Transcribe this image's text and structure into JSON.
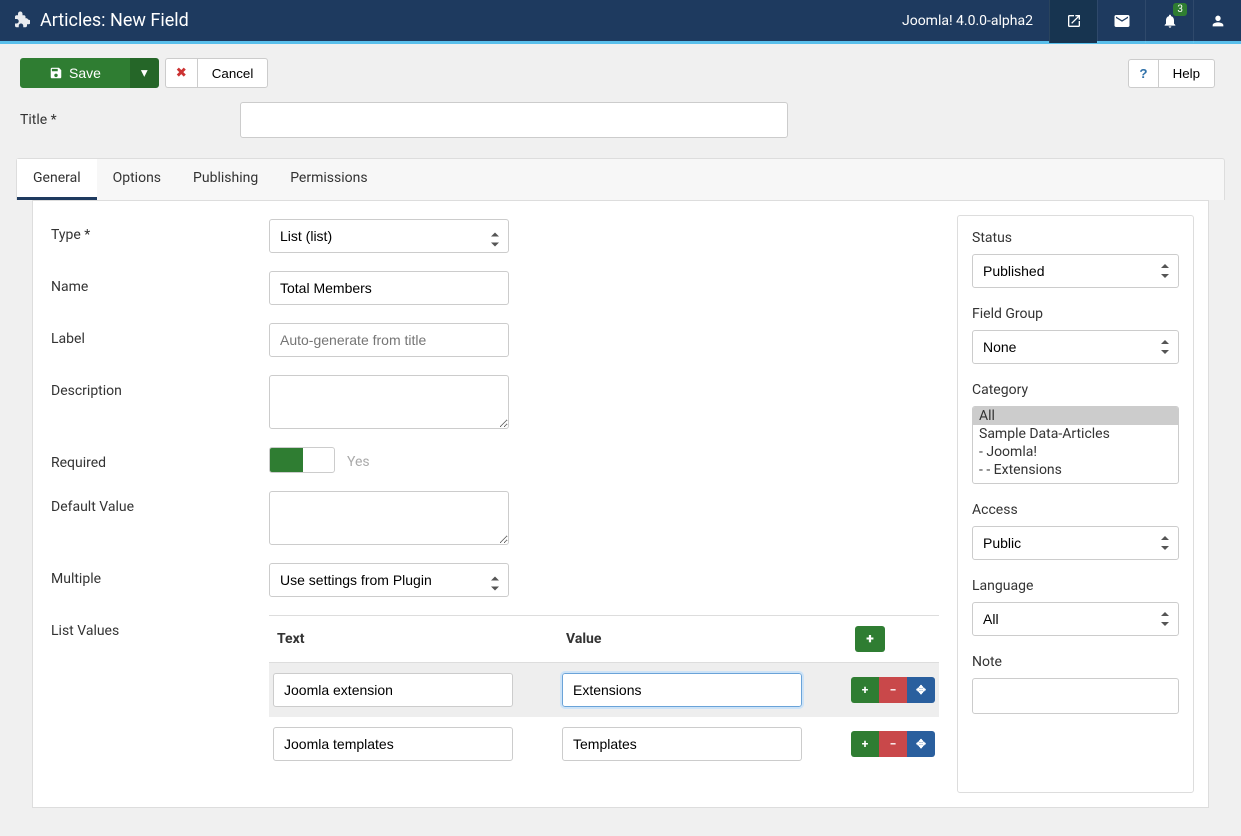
{
  "topbar": {
    "title": "Articles: New Field",
    "version": "Joomla! 4.0.0-alpha2",
    "notif_count": "3"
  },
  "toolbar": {
    "save": "Save",
    "cancel": "Cancel",
    "help": "Help"
  },
  "title_field": {
    "label": "Title *",
    "value": ""
  },
  "tabs": [
    "General",
    "Options",
    "Publishing",
    "Permissions"
  ],
  "form": {
    "type": {
      "label": "Type *",
      "value": "List (list)"
    },
    "name": {
      "label": "Name",
      "value": "Total Members"
    },
    "lbl": {
      "label": "Label",
      "placeholder": "Auto-generate from title",
      "value": ""
    },
    "description": {
      "label": "Description",
      "value": ""
    },
    "required": {
      "label": "Required",
      "text": "Yes"
    },
    "default_value": {
      "label": "Default Value",
      "value": ""
    },
    "multiple": {
      "label": "Multiple",
      "value": "Use settings from Plugin"
    },
    "list_values": {
      "label": "List Values",
      "th_text": "Text",
      "th_value": "Value",
      "rows": [
        {
          "text": "Joomla extension",
          "value": "Extensions"
        },
        {
          "text": "Joomla templates",
          "value": "Templates"
        }
      ]
    }
  },
  "sidebar": {
    "status": {
      "label": "Status",
      "value": "Published"
    },
    "field_group": {
      "label": "Field Group",
      "value": "None"
    },
    "category": {
      "label": "Category",
      "items": [
        "All",
        "Sample Data-Articles",
        "- Joomla!",
        "- - Extensions"
      ]
    },
    "access": {
      "label": "Access",
      "value": "Public"
    },
    "language": {
      "label": "Language",
      "value": "All"
    },
    "note": {
      "label": "Note",
      "value": ""
    }
  }
}
